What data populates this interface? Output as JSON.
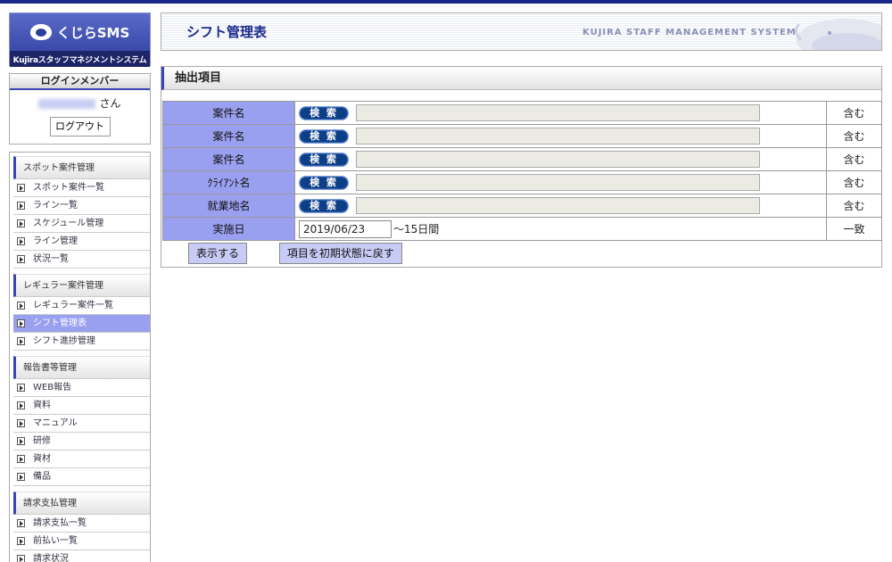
{
  "logo": {
    "brand": "くじらSMS",
    "tagline": "Kujiraスタッフマネジメントシステム"
  },
  "login": {
    "heading": "ログインメンバー",
    "suffix": "さん",
    "logout_label": "ログアウト"
  },
  "nav": [
    {
      "heading": "スポット案件管理",
      "items": [
        {
          "label": "スポット案件一覧",
          "active": false
        },
        {
          "label": "ライン一覧",
          "active": false
        },
        {
          "label": "スケジュール管理",
          "active": false
        },
        {
          "label": "ライン管理",
          "active": false
        },
        {
          "label": "状況一覧",
          "active": false
        }
      ]
    },
    {
      "heading": "レギュラー案件管理",
      "items": [
        {
          "label": "レギュラー案件一覧",
          "active": false
        },
        {
          "label": "シフト管理表",
          "active": true
        },
        {
          "label": "シフト進捗管理",
          "active": false
        }
      ]
    },
    {
      "heading": "報告書等管理",
      "items": [
        {
          "label": "WEB報告",
          "active": false
        },
        {
          "label": "資料",
          "active": false
        },
        {
          "label": "マニュアル",
          "active": false
        },
        {
          "label": "研修",
          "active": false
        },
        {
          "label": "資材",
          "active": false
        },
        {
          "label": "備品",
          "active": false
        }
      ]
    },
    {
      "heading": "請求支払管理",
      "items": [
        {
          "label": "請求支払一覧",
          "active": false
        },
        {
          "label": "前払い一覧",
          "active": false
        },
        {
          "label": "請求状況",
          "active": false
        }
      ]
    }
  ],
  "header": {
    "title": "シフト管理表",
    "system_name": "KUJIRA STAFF MANAGEMENT SYSTEM"
  },
  "filter": {
    "heading": "抽出項目",
    "search_label": "検 索",
    "rows": [
      {
        "label": "案件名",
        "value": "",
        "mode": "含む"
      },
      {
        "label": "案件名",
        "value": "",
        "mode": "含む"
      },
      {
        "label": "案件名",
        "value": "",
        "mode": "含む"
      },
      {
        "label": "ｸﾗｲｱﾝﾄ名",
        "value": "",
        "mode": "含む"
      },
      {
        "label": "就業地名",
        "value": "",
        "mode": "含む"
      }
    ],
    "date_row": {
      "label": "実施日",
      "value": "2019/06/23",
      "suffix": "～15日間",
      "mode": "一致"
    },
    "show_label": "表示する",
    "reset_label": "項目を初期状態に戻す"
  },
  "colors": {
    "accent": "#1a2a8c",
    "label_bg": "#9aa0f0",
    "search_btn": "#0c3f86"
  }
}
